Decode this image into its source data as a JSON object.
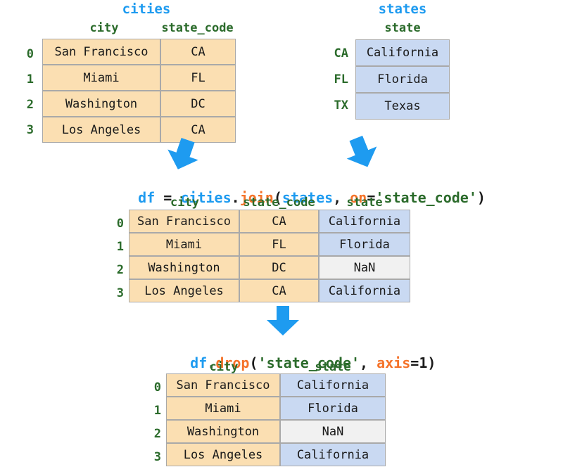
{
  "colors": {
    "title_blue": "#1e9bf0",
    "header_green": "#2b6b2b",
    "cell_orange": "#fbdfb2",
    "cell_blue": "#c9d9f2",
    "cell_gray": "#f1f1f1",
    "cell_border": "#a9a9a9",
    "arrow_blue": "#1e9bf0",
    "code_function": "#f5732a",
    "code_string": "#2b6b2b"
  },
  "tables": {
    "cities": {
      "title": "cities",
      "columns": [
        "city",
        "state_code"
      ],
      "index": [
        "0",
        "1",
        "2",
        "3"
      ],
      "rows": [
        [
          "San Francisco",
          "CA"
        ],
        [
          "Miami",
          "FL"
        ],
        [
          "Washington",
          "DC"
        ],
        [
          "Los Angeles",
          "CA"
        ]
      ]
    },
    "states": {
      "title": "states",
      "columns": [
        "state"
      ],
      "index": [
        "CA",
        "FL",
        "TX"
      ],
      "rows": [
        [
          "California"
        ],
        [
          "Florida"
        ],
        [
          "Texas"
        ]
      ]
    },
    "joined": {
      "columns": [
        "city",
        "state_code",
        "state"
      ],
      "index": [
        "0",
        "1",
        "2",
        "3"
      ],
      "rows": [
        [
          "San Francisco",
          "CA",
          "California"
        ],
        [
          "Miami",
          "FL",
          "Florida"
        ],
        [
          "Washington",
          "DC",
          "NaN"
        ],
        [
          "Los Angeles",
          "CA",
          "California"
        ]
      ]
    },
    "dropped": {
      "columns": [
        "city",
        "state"
      ],
      "index": [
        "0",
        "1",
        "2",
        "3"
      ],
      "rows": [
        [
          "San Francisco",
          "California"
        ],
        [
          "Miami",
          "Florida"
        ],
        [
          "Washington",
          "NaN"
        ],
        [
          "Los Angeles",
          "California"
        ]
      ]
    }
  },
  "code": {
    "join": {
      "full": "df = cities.join(states, on='state_code')",
      "tokens": {
        "df": "df",
        "eq": " = ",
        "cities": "cities",
        "dot": ".",
        "join": "join",
        "open": "(",
        "states": "states",
        "comma": ", ",
        "on": "on",
        "eq2": "=",
        "arg": "'state_code'",
        "close": ")"
      }
    },
    "drop": {
      "full": "df.drop('state_code', axis=1)",
      "tokens": {
        "df": "df",
        "dot": ".",
        "drop": "drop",
        "open": "(",
        "arg": "'state_code'",
        "comma": ", ",
        "axis": "axis",
        "eq": "=",
        "num": "1",
        "close": ")"
      }
    }
  },
  "arrows": {
    "cities_to_join": "arrow-down-right-tilt",
    "states_to_join": "arrow-down-left-tilt",
    "join_to_drop": "arrow-down"
  }
}
